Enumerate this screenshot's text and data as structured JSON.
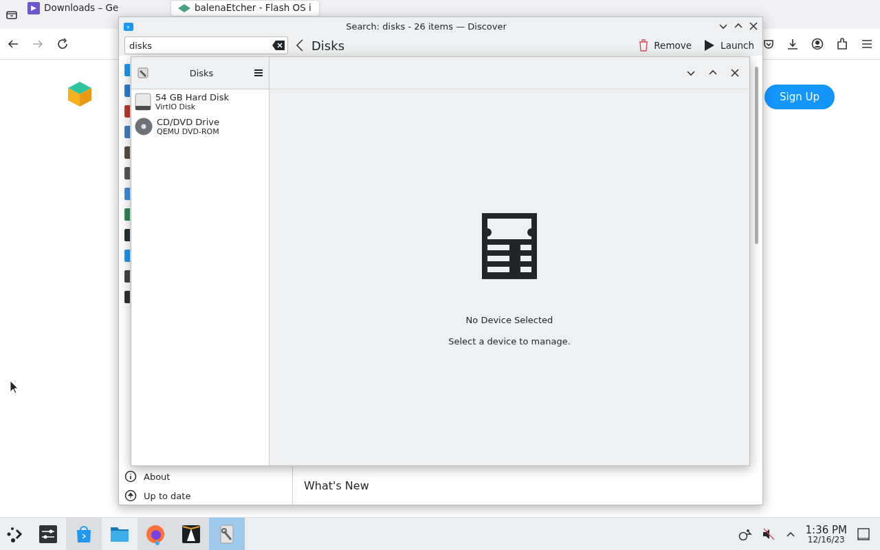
{
  "browser": {
    "tabs": [
      {
        "title": "Downloads – Ge",
        "selected": false
      },
      {
        "title": "balenaEtcher - Flash OS i",
        "selected": true
      }
    ],
    "page_button": "Sign Up"
  },
  "discover": {
    "title": "Search: disks - 26 items — Discover",
    "search": "disks",
    "page_title": "Disks",
    "actions": [
      {
        "label": "Remove",
        "kind": "remove"
      },
      {
        "label": "Launch",
        "kind": "launch"
      }
    ],
    "sidebar_bottom": [
      {
        "label": "About",
        "kind": "about"
      },
      {
        "label": "Up to date",
        "kind": "update"
      }
    ],
    "section_title": "What's New"
  },
  "disks": {
    "title": "Disks",
    "devices": [
      {
        "name": "54 GB Hard Disk",
        "model": "VirtIO Disk",
        "kind": "hdd",
        "selected": false
      },
      {
        "name": "CD/DVD Drive",
        "model": "QEMU DVD-ROM",
        "kind": "optical",
        "selected": false
      }
    ],
    "empty_title": "No Device Selected",
    "empty_message": "Select a device to manage."
  },
  "taskbar": {
    "items": [
      {
        "kind": "settings",
        "open": false,
        "selected": false
      },
      {
        "kind": "discover",
        "open": true,
        "selected": false
      },
      {
        "kind": "files",
        "open": false,
        "selected": false
      },
      {
        "kind": "firefox",
        "open": true,
        "selected": false
      },
      {
        "kind": "terminal",
        "open": true,
        "selected": false
      },
      {
        "kind": "disks",
        "open": true,
        "selected": true
      }
    ],
    "time": "1:36 PM",
    "date": "12/16/23"
  }
}
